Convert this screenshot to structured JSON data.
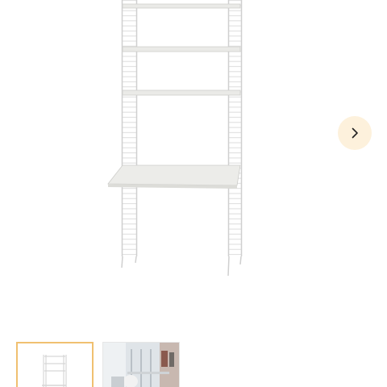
{
  "gallery": {
    "main_image": {
      "icon": "string-shelf-desk-product-image"
    },
    "next_button": {
      "icon": "chevron-right-icon"
    },
    "thumbnails": [
      {
        "icon": "shelf-product-thumbnail",
        "selected": true
      },
      {
        "icon": "room-scene-thumbnail",
        "selected": false
      }
    ]
  },
  "colors": {
    "next_button_bg": "#fdf1dc",
    "selected_thumb_border": "#f0c070",
    "shelf_frame": "#e2e2e2",
    "shelf_board": "#e9e9e6"
  }
}
